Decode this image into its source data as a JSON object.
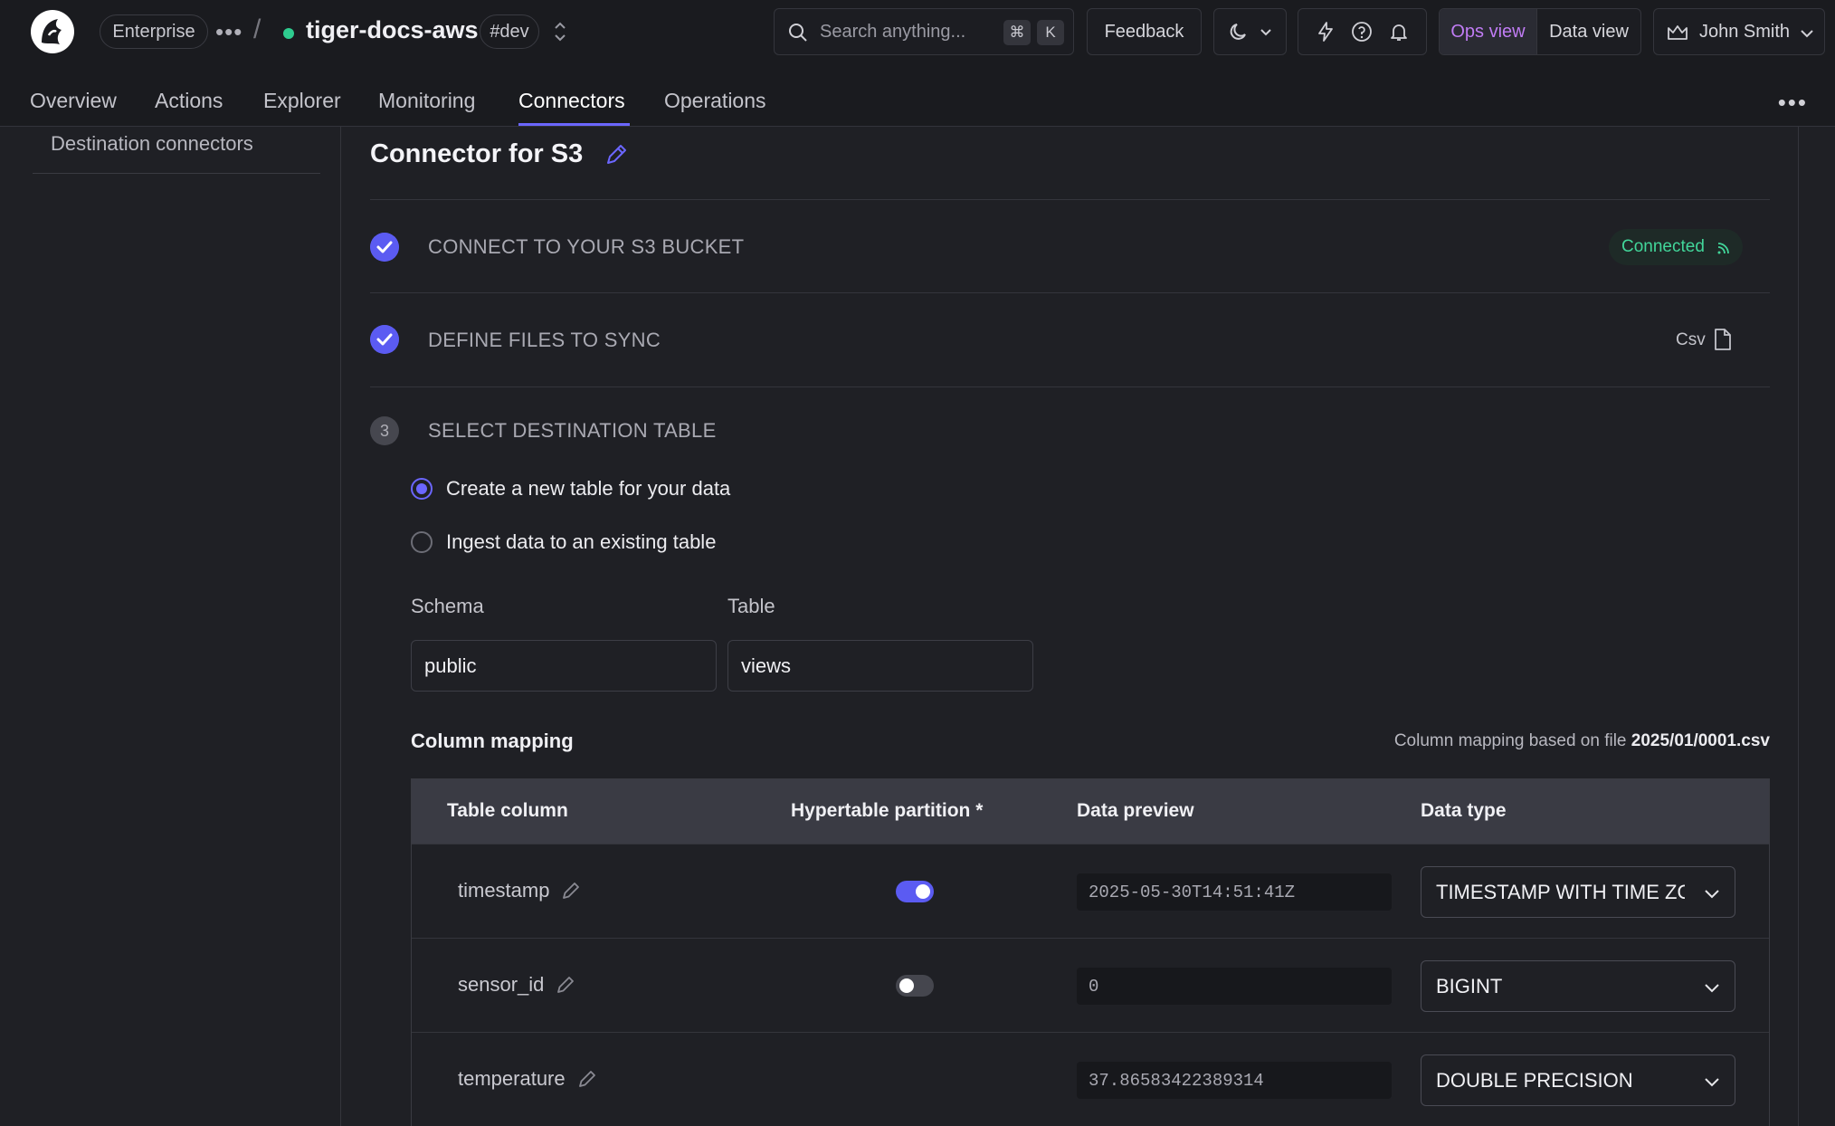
{
  "header": {
    "plan": "Enterprise",
    "service_name": "tiger-docs-aws",
    "env_tag": "#dev",
    "search_placeholder": "Search anything...",
    "shortcut_keys": [
      "⌘",
      "K"
    ],
    "feedback_label": "Feedback",
    "ops_view_label": "Ops view",
    "data_view_label": "Data view",
    "user_name": "John Smith",
    "service_status_color": "#2ecc8f"
  },
  "tabs": [
    {
      "label": "Overview"
    },
    {
      "label": "Actions"
    },
    {
      "label": "Explorer"
    },
    {
      "label": "Monitoring"
    },
    {
      "label": "Connectors",
      "active": true
    },
    {
      "label": "Operations"
    }
  ],
  "sidebar": {
    "items": [
      {
        "label": "Destination connectors"
      }
    ]
  },
  "main": {
    "title": "Connector for S3",
    "steps": [
      {
        "label": "CONNECT TO YOUR S3 BUCKET",
        "status": "complete",
        "badge": "Connected"
      },
      {
        "label": "DEFINE FILES TO SYNC",
        "status": "complete",
        "badge": "Csv"
      },
      {
        "label": "SELECT DESTINATION TABLE",
        "status": "current",
        "number": "3"
      }
    ],
    "options": [
      {
        "label": "Create a new table for your data",
        "selected": true
      },
      {
        "label": "Ingest data to an existing table",
        "selected": false
      }
    ],
    "schema_label": "Schema",
    "schema_value": "public",
    "table_label": "Table",
    "table_value": "views",
    "column_mapping": {
      "title": "Column mapping",
      "note_prefix": "Column mapping based on file",
      "note_file": "2025/01/0001.csv",
      "headers": [
        "Table column",
        "Hypertable partition *",
        "Data preview",
        "Data type"
      ],
      "rows": [
        {
          "column": "timestamp",
          "partition": true,
          "preview": "2025-05-30T14:51:41Z",
          "type": "TIMESTAMP WITH TIME ZONE"
        },
        {
          "column": "sensor_id",
          "partition": false,
          "preview": "0",
          "type": "BIGINT"
        },
        {
          "column": "temperature",
          "partition": null,
          "preview": "37.86583422389314",
          "type": "DOUBLE PRECISION"
        }
      ]
    }
  },
  "colors": {
    "accent": "#5b5bf2",
    "ops_view": "#c07cf4",
    "connected": "#42d69a"
  }
}
